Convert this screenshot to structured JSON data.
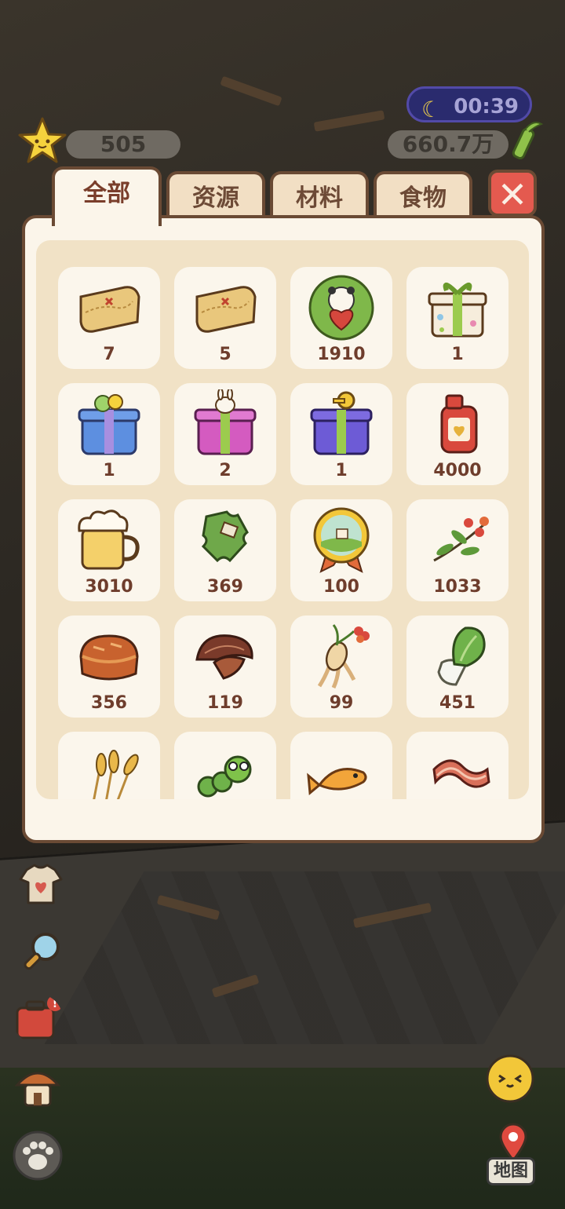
{
  "hud": {
    "stars": "505",
    "coins": "660.7万",
    "time": "00:39"
  },
  "tabs": [
    {
      "label": "全部",
      "active": true
    },
    {
      "label": "资源",
      "active": false
    },
    {
      "label": "材料",
      "active": false
    },
    {
      "label": "食物",
      "active": false
    }
  ],
  "close_label": "✕",
  "items": [
    {
      "icon": "treasure-map-icon",
      "count": "7"
    },
    {
      "icon": "treasure-map-icon",
      "count": "5"
    },
    {
      "icon": "panda-heart-badge-icon",
      "count": "1910"
    },
    {
      "icon": "polka-dot-gift-icon",
      "count": "1"
    },
    {
      "icon": "blue-flower-gift-icon",
      "count": "1"
    },
    {
      "icon": "pink-bunny-gift-icon",
      "count": "2"
    },
    {
      "icon": "purple-key-gift-icon",
      "count": "1"
    },
    {
      "icon": "jam-jar-icon",
      "count": "4000"
    },
    {
      "icon": "beer-mug-icon",
      "count": "3010"
    },
    {
      "icon": "puzzle-piece-icon",
      "count": "369"
    },
    {
      "icon": "landscape-medal-icon",
      "count": "100"
    },
    {
      "icon": "berry-branch-icon",
      "count": "1033"
    },
    {
      "icon": "bread-icon",
      "count": "356"
    },
    {
      "icon": "mushroom-icon",
      "count": "119"
    },
    {
      "icon": "ginseng-icon",
      "count": "99"
    },
    {
      "icon": "bok-choy-icon",
      "count": "451"
    },
    {
      "icon": "wheat-icon",
      "count": ""
    },
    {
      "icon": "caterpillar-icon",
      "count": ""
    },
    {
      "icon": "fish-icon",
      "count": ""
    },
    {
      "icon": "bacon-icon",
      "count": ""
    }
  ],
  "map_label": "地图",
  "colors": {
    "panel_border": "#6a4a34",
    "panel_bg": "#fbf5ea",
    "inner_bg": "#f1e2c6",
    "tab_text": "#7a3e2b",
    "close_red": "#e45a4f"
  }
}
